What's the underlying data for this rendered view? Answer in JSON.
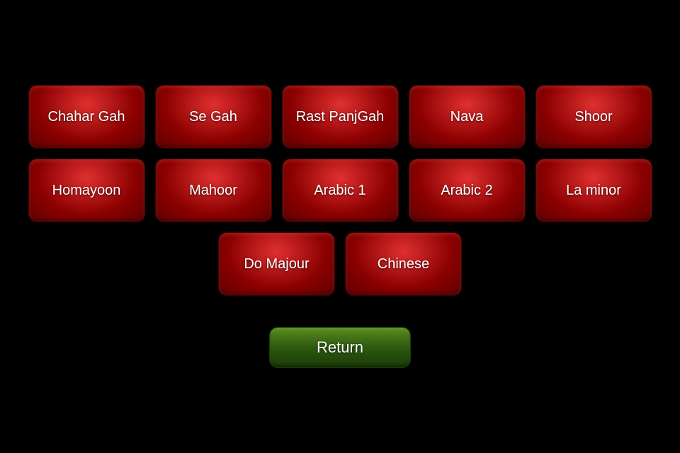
{
  "buttons": {
    "row1": [
      {
        "label": "Chahar Gah",
        "id": "chahar-gah"
      },
      {
        "label": "Se Gah",
        "id": "se-gah"
      },
      {
        "label": "Rast PanjGah",
        "id": "rast-panjgah"
      },
      {
        "label": "Nava",
        "id": "nava"
      },
      {
        "label": "Shoor",
        "id": "shoor"
      }
    ],
    "row2": [
      {
        "label": "Homayoon",
        "id": "homayoon"
      },
      {
        "label": "Mahoor",
        "id": "mahoor"
      },
      {
        "label": "Arabic 1",
        "id": "arabic-1"
      },
      {
        "label": "Arabic 2",
        "id": "arabic-2"
      },
      {
        "label": "La minor",
        "id": "la-minor"
      }
    ],
    "row3": [
      {
        "label": "Do Majour",
        "id": "do-majour"
      },
      {
        "label": "Chinese",
        "id": "chinese"
      }
    ]
  },
  "return_label": "Return"
}
